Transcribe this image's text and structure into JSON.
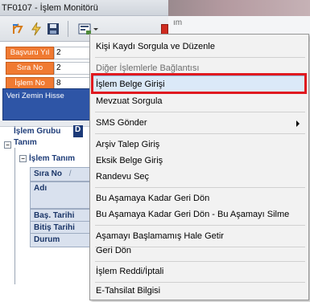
{
  "window": {
    "title": "TF0107 - İşlem Monitörü",
    "right_title": "ım"
  },
  "form": {
    "fields": [
      {
        "label": "Başvuru Yıl",
        "value": "2"
      },
      {
        "label": "Sıra No",
        "value": "2"
      },
      {
        "label": "İşlem No",
        "value": "8"
      }
    ],
    "panel_label": "Veri Zemin Hisse"
  },
  "grid": {
    "group_label": "İşlem Grubu",
    "group_sub": "Tanım",
    "dark_cell": "D",
    "sub_group_label": "İşlem Tanım",
    "columns": [
      "Sıra No",
      "Adı",
      "Baş. Tarihi",
      "Bitiş Tarihi",
      "Durum"
    ],
    "sort_glyph": "/"
  },
  "context_menu": {
    "items": [
      {
        "label": "Kişi Kaydı Sorgula ve Düzenle",
        "enabled": true
      },
      {
        "label": "Diğer İşlemlerle Bağlantısı",
        "enabled": false
      },
      {
        "label": "İşlem Belge Girişi",
        "enabled": true,
        "selected": true
      },
      {
        "label": "Mevzuat Sorgula",
        "enabled": true
      },
      {
        "label": "SMS Gönder",
        "enabled": true,
        "submenu": true
      },
      {
        "label": "Arşiv Talep Giriş",
        "enabled": true
      },
      {
        "label": "Eksik Belge Giriş",
        "enabled": true
      },
      {
        "label": "Randevu Seç",
        "enabled": true
      },
      {
        "label": "Bu Aşamaya Kadar Geri Dön",
        "enabled": true
      },
      {
        "label": "Bu Aşamaya Kadar Geri Dön - Bu Aşamayı Silme",
        "enabled": true
      },
      {
        "label": "Aşamayı Başlamamış Hale Getir",
        "enabled": true
      },
      {
        "label": "Geri Dön",
        "enabled": true
      },
      {
        "label": "İşlem Reddi/İptali",
        "enabled": true
      },
      {
        "label": "E-Tahsilat Bilgisi",
        "enabled": true
      }
    ]
  },
  "colors": {
    "field_label_bg": "#f07a32",
    "panel_bg": "#2e55a6",
    "selection_bg": "#dbe9f8",
    "highlight_border": "#e0191f"
  }
}
